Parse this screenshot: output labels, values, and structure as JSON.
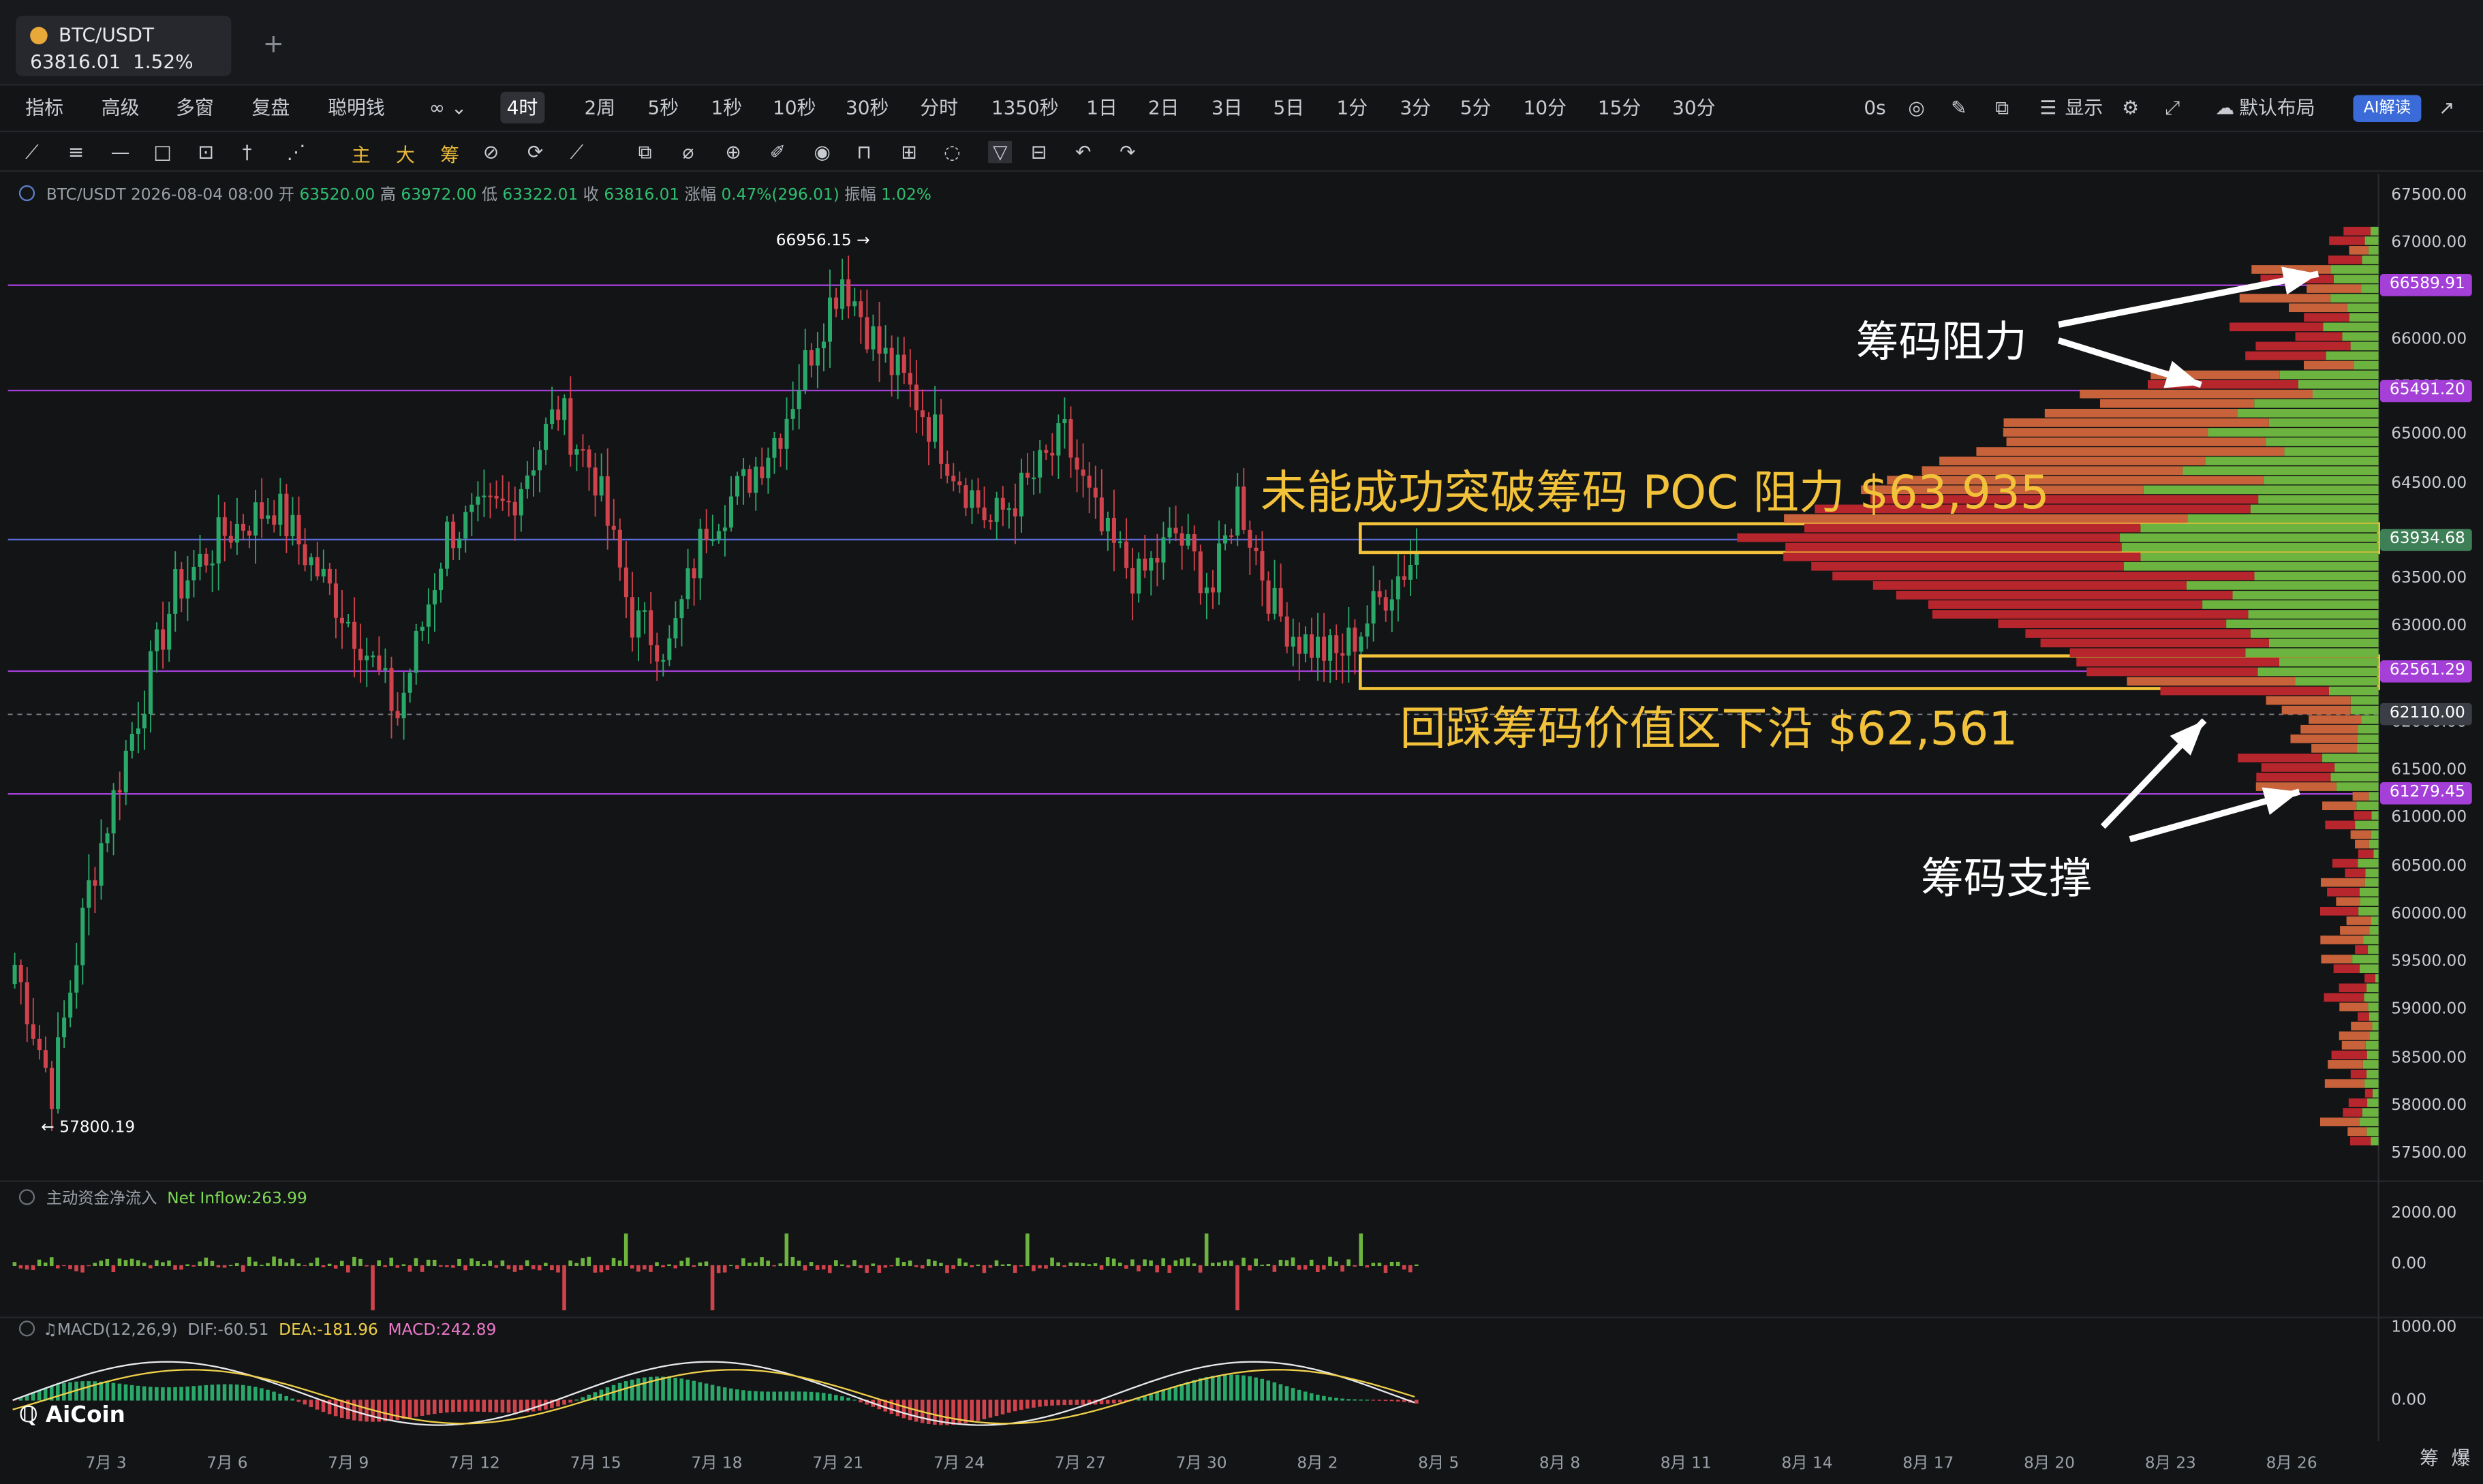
{
  "tab": {
    "symbol": "BTC/USDT",
    "price": "63816.01",
    "change": "1.52%",
    "add": "+"
  },
  "toolbar": {
    "left": [
      "指标",
      "高级",
      "多窗",
      "复盘",
      "聪明钱"
    ],
    "timeframes": [
      "4时",
      "2周",
      "5秒",
      "1秒",
      "10秒",
      "30秒",
      "分时",
      "1350秒",
      "1日",
      "2日",
      "3日",
      "5日",
      "1分",
      "3分",
      "5分",
      "10分",
      "15分",
      "30分"
    ],
    "selected": "4时",
    "right": {
      "os": "0s",
      "display": "显示",
      "layout": "默认布局",
      "ai": "AI解读"
    }
  },
  "draw_tools": {
    "labels": [
      "主",
      "大",
      "筹"
    ]
  },
  "legend": {
    "symbol": "BTC/USDT",
    "time": "2026-08-04 08:00",
    "open_label": "开",
    "open": "63520.00",
    "high_label": "高",
    "high": "63972.00",
    "low_label": "低",
    "low": "63322.01",
    "close_label": "收",
    "close": "63816.01",
    "chg_label": "涨幅",
    "chg": "0.47%(296.01)",
    "amp_label": "振幅",
    "amp": "1.02%"
  },
  "price_axis": {
    "ticks": [
      "67500.00",
      "67000.00",
      "66000.00",
      "65500.00",
      "65000.00",
      "64500.00",
      "63500.00",
      "63000.00",
      "62000.00",
      "61500.00",
      "61000.00",
      "60500.00",
      "60000.00",
      "59500.00",
      "59000.00",
      "58500.00",
      "58000.00",
      "57500.00"
    ]
  },
  "price_tags": {
    "t1": "66589.91",
    "t2": "65491.20",
    "t3": "63934.68",
    "t4": "62561.29",
    "t5": "62110.00",
    "t6": "61279.45"
  },
  "high_label": "66956.15 →",
  "low_label": "← 57800.19",
  "annotations": {
    "resist": "筹码阻力",
    "poc": "未能成功突破筹码 POC 阻力 $63,935",
    "lower": "回踩筹码价值区下沿 $62,561",
    "support": "筹码支撑"
  },
  "inflow": {
    "title": "主动资金净流入",
    "label": "Net Inflow:",
    "value": "263.99",
    "ticks": [
      "2000.00",
      "0.00"
    ]
  },
  "macd": {
    "title": "MACD(12,26,9)",
    "dif": "DIF:-60.51",
    "dea": "DEA:-181.96",
    "macd": "MACD:242.89",
    "ticks": [
      "1000.00",
      "0.00"
    ]
  },
  "x_axis": [
    "7月 3",
    "7月 6",
    "7月 9",
    "7月 12",
    "7月 15",
    "7月 18",
    "7月 21",
    "7月 24",
    "7月 27",
    "7月 30",
    "8月 2",
    "8月 5",
    "8月 8",
    "8月 11",
    "8月 14",
    "8月 17",
    "8月 20",
    "8月 23",
    "8月 26"
  ],
  "bottom": {
    "a": "筹",
    "b": "爆"
  },
  "logo": "AiCoin",
  "chart_data": {
    "type": "candlestick",
    "symbol": "BTC/USDT",
    "interval": "4时",
    "ylim": [
      57500,
      67700
    ],
    "levels": [
      66589.91,
      65491.2,
      63934.68,
      62561.29,
      62110.0,
      61279.45
    ],
    "high": 66956.15,
    "low": 57800.19,
    "anchors": [
      [
        0,
        59500
      ],
      [
        6,
        58200
      ],
      [
        12,
        60300
      ],
      [
        18,
        61700
      ],
      [
        26,
        63400
      ],
      [
        34,
        64000
      ],
      [
        42,
        64300
      ],
      [
        50,
        63500
      ],
      [
        56,
        62900
      ],
      [
        62,
        62100
      ],
      [
        70,
        64000
      ],
      [
        80,
        64300
      ],
      [
        88,
        65300
      ],
      [
        94,
        64600
      ],
      [
        100,
        63100
      ],
      [
        106,
        62800
      ],
      [
        112,
        64100
      ],
      [
        118,
        64500
      ],
      [
        124,
        65100
      ],
      [
        130,
        66100
      ],
      [
        134,
        66700
      ],
      [
        140,
        65900
      ],
      [
        146,
        65400
      ],
      [
        152,
        64700
      ],
      [
        158,
        64100
      ],
      [
        164,
        64500
      ],
      [
        170,
        65000
      ],
      [
        176,
        64000
      ],
      [
        182,
        63500
      ],
      [
        188,
        64000
      ],
      [
        194,
        63400
      ],
      [
        198,
        64400
      ],
      [
        204,
        63200
      ],
      [
        208,
        62900
      ],
      [
        214,
        62700
      ],
      [
        218,
        63000
      ],
      [
        222,
        63400
      ],
      [
        227,
        63800
      ]
    ],
    "profile_min": 57600,
    "profile_max": 67200
  },
  "colors": {
    "up": "#2aa86a",
    "down": "#d0434c",
    "level": "#a43fd8",
    "box": "#f2c23a",
    "vol_green": "#6db33f",
    "vol_red": "#b8262d",
    "vol_orange": "#c8623b"
  }
}
